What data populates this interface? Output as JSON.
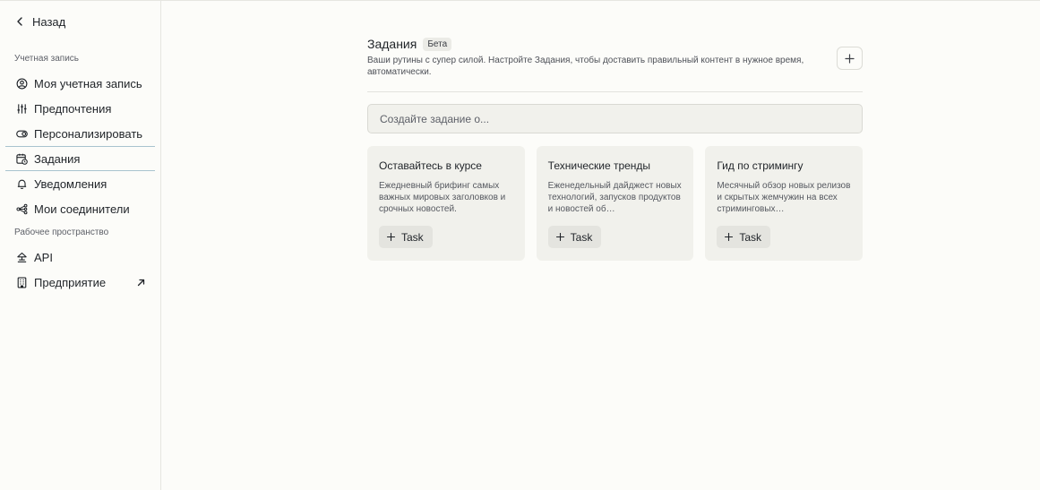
{
  "sidebar": {
    "back_label": "Назад",
    "account_section": "Учетная запись",
    "workspace_section": "Рабочее пространство",
    "items": [
      {
        "label": "Моя учетная запись",
        "icon": "user-circle-icon"
      },
      {
        "label": "Предпочтения",
        "icon": "sliders-icon"
      },
      {
        "label": "Персонализировать",
        "icon": "toggle-icon"
      },
      {
        "label": "Задания",
        "icon": "calendar-clock-icon",
        "active": true
      },
      {
        "label": "Уведомления",
        "icon": "bell-icon"
      },
      {
        "label": "Мои соединители",
        "icon": "connectors-icon"
      }
    ],
    "workspace_items": [
      {
        "label": "API",
        "icon": "api-icon"
      },
      {
        "label": "Предприятие",
        "icon": "building-icon",
        "external": true
      }
    ]
  },
  "main": {
    "title": "Задания",
    "badge": "Бета",
    "description": "Ваши рутины с супер силой. Настройте Задания, чтобы доставить правильный контент в нужное время, автоматически.",
    "create_placeholder": "Создайте задание о...",
    "cards": [
      {
        "title": "Оставайтесь в курсе",
        "description": "Ежедневный брифинг самых важных мировых заголовков и срочных новостей.",
        "button": "Task"
      },
      {
        "title": "Технические тренды",
        "description": "Еженедельный дайджест новых технологий, запусков продуктов и новостей об…",
        "button": "Task"
      },
      {
        "title": "Гид по стримингу",
        "description": "Месячный обзор новых релизов и скрытых жемчужин на всех стриминговых…",
        "button": "Task"
      }
    ]
  },
  "colors": {
    "background": "#fcfcf9",
    "card": "#f1f1ec",
    "active_border": "#a8c3cf"
  }
}
